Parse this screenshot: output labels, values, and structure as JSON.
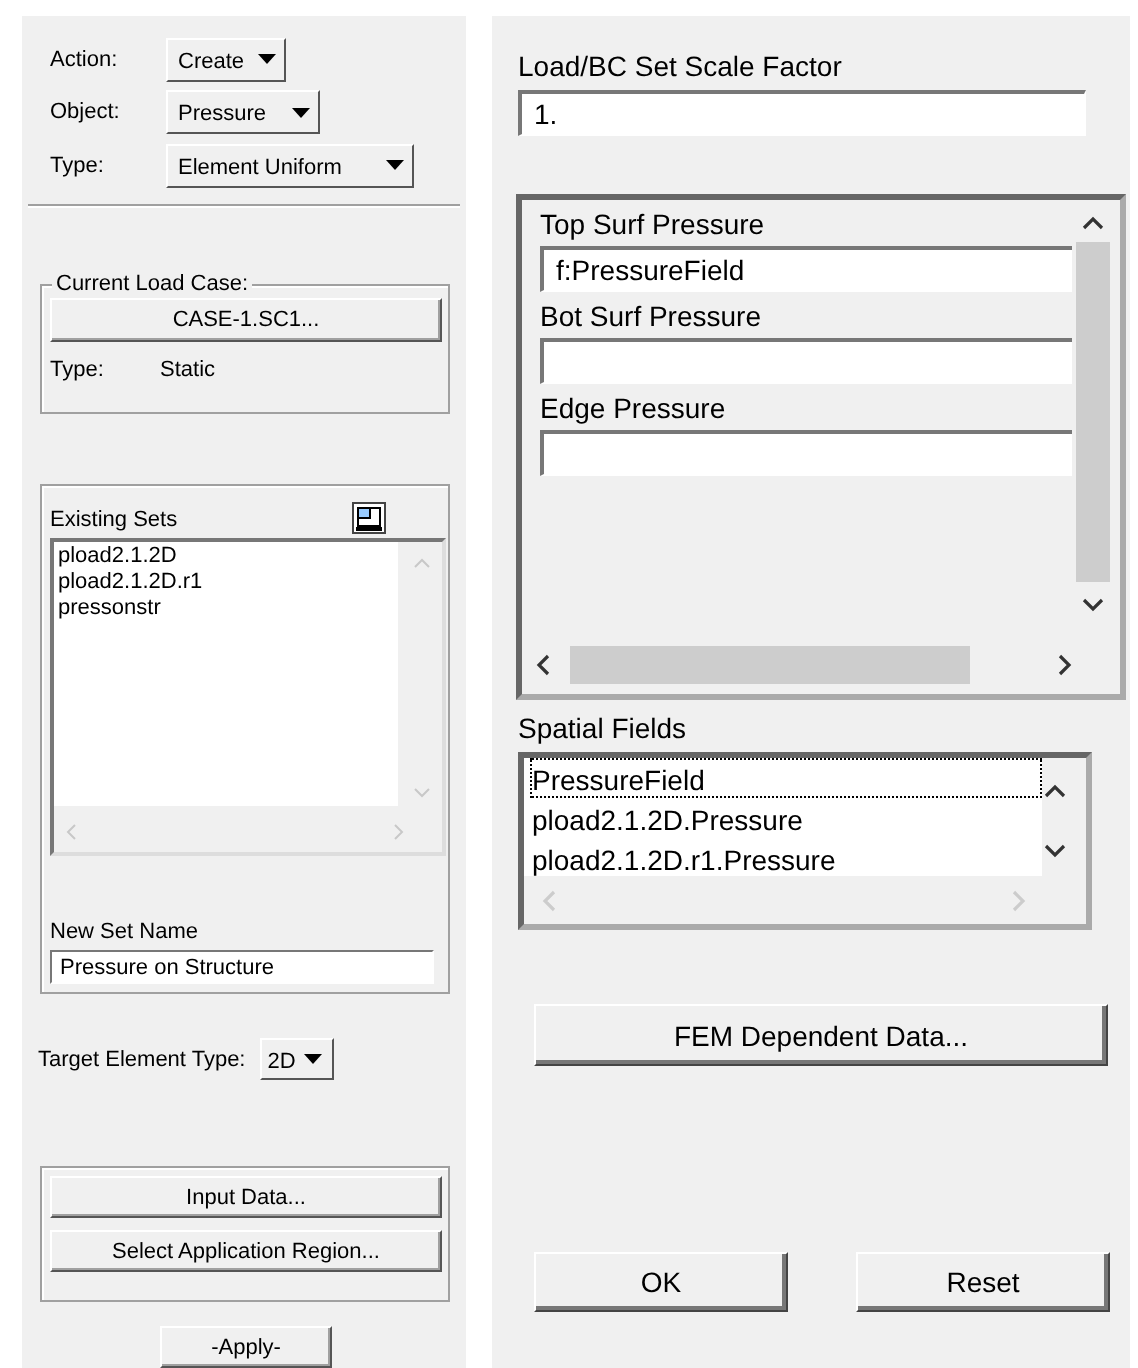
{
  "selectors": [
    {
      "label": "Action:",
      "value": "Create"
    },
    {
      "label": "Object:",
      "value": "Pressure"
    },
    {
      "label": "Type:",
      "value": "Element Uniform"
    }
  ],
  "load_case": {
    "legend": "Current Load Case:",
    "button": "CASE-1.SC1...",
    "type_label": "Type:",
    "type_value": "Static"
  },
  "existing_sets": {
    "label": "Existing Sets",
    "items": [
      "pload2.1.2D",
      "pload2.1.2D.r1",
      "pressonstr"
    ]
  },
  "new_set_name": {
    "label": "New Set Name",
    "value": "Pressure on Structure"
  },
  "target_element_type": {
    "label": "Target Element Type:",
    "value": "2D"
  },
  "action_buttons": [
    "Input Data...",
    "Select Application Region..."
  ],
  "apply_button": "-Apply-",
  "scale_factor": {
    "label": "Load/BC Set Scale Factor",
    "value": "1."
  },
  "input_fields": [
    {
      "label": "Top Surf Pressure",
      "value": "f:PressureField"
    },
    {
      "label": "Bot Surf Pressure"
    },
    {
      "label": "Edge Pressure"
    }
  ],
  "spatial_fields": {
    "label": "Spatial Fields",
    "items": [
      {
        "name": "PressureField",
        "selected": true
      },
      {
        "name": "pload2.1.2D.Pressure",
        "selected": false
      },
      {
        "name": "pload2.1.2D.r1.Pressure",
        "selected": false
      }
    ]
  },
  "fem_button": "FEM Dependent Data...",
  "buttons": [
    "OK",
    "Reset"
  ]
}
